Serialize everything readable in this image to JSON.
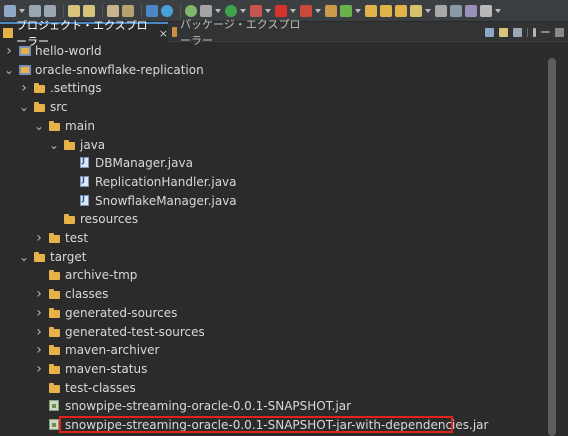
{
  "tabs": [
    {
      "label": "プロジェクト・エクスプローラー",
      "active": true,
      "close": "×"
    },
    {
      "label": "パッケージ・エクスプローラー",
      "active": false
    }
  ],
  "tree": [
    {
      "label": "hello-world",
      "type": "project",
      "expanded": false
    },
    {
      "label": "oracle-snowflake-replication",
      "type": "project",
      "expanded": true
    },
    {
      "label": ".settings",
      "type": "folder",
      "expanded": false
    },
    {
      "label": "src",
      "type": "folder",
      "expanded": true
    },
    {
      "label": "main",
      "type": "folder",
      "expanded": true
    },
    {
      "label": "java",
      "type": "folder",
      "expanded": true
    },
    {
      "label": "DBManager.java",
      "type": "file"
    },
    {
      "label": "ReplicationHandler.java",
      "type": "file"
    },
    {
      "label": "SnowflakeManager.java",
      "type": "file"
    },
    {
      "label": "resources",
      "type": "folder"
    },
    {
      "label": "test",
      "type": "folder",
      "expanded": false
    },
    {
      "label": "target",
      "type": "folder",
      "expanded": true
    },
    {
      "label": "archive-tmp",
      "type": "folder"
    },
    {
      "label": "classes",
      "type": "folder",
      "expanded": false
    },
    {
      "label": "generated-sources",
      "type": "folder",
      "expanded": false
    },
    {
      "label": "generated-test-sources",
      "type": "folder",
      "expanded": false
    },
    {
      "label": "maven-archiver",
      "type": "folder",
      "expanded": false
    },
    {
      "label": "maven-status",
      "type": "folder",
      "expanded": false
    },
    {
      "label": "test-classes",
      "type": "folder"
    },
    {
      "label": "snowpipe-streaming-oracle-0.0.1-SNAPSHOT.jar",
      "type": "jar"
    },
    {
      "label": "snowpipe-streaming-oracle-0.0.1-SNAPSHOT-jar-with-dependencies.jar",
      "type": "jar",
      "highlighted": true
    }
  ],
  "colors": {
    "background": "#2b2b2b",
    "highlight_border": "#e0241d",
    "folder": "#e8b24a",
    "active_tab_accent": "#4a88c7"
  }
}
